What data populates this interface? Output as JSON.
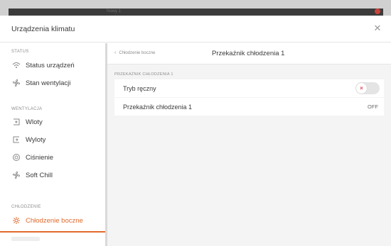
{
  "background": {
    "ghost_text": "Nowy 1"
  },
  "modal": {
    "title": "Urządzenia klimatu"
  },
  "sidebar": {
    "sections": [
      {
        "label": "STATUS",
        "items": [
          {
            "label": "Status urządzeń",
            "icon": "wifi-signal-icon"
          },
          {
            "label": "Stan wentylacji",
            "icon": "fan-icon"
          }
        ]
      },
      {
        "label": "WENTYLACJA",
        "items": [
          {
            "label": "Wloty",
            "icon": "inlet-icon"
          },
          {
            "label": "Wyloty",
            "icon": "outlet-icon"
          },
          {
            "label": "Ciśnienie",
            "icon": "pressure-gauge-icon"
          },
          {
            "label": "Soft Chill",
            "icon": "fan-icon"
          }
        ]
      },
      {
        "label": "CHŁODZENIE",
        "items": [
          {
            "label": "Chłodzenie boczne",
            "icon": "gear-icon",
            "active": true
          }
        ]
      }
    ]
  },
  "content": {
    "breadcrumb_back": "Chłodzenie boczne",
    "page_title": "Przekaźnik chłodzenia 1",
    "group_label": "PRZEKAŹNIK CHŁODZENIA 1",
    "rows": [
      {
        "label": "Tryb ręczny",
        "type": "toggle",
        "state": "off"
      },
      {
        "label": "Przekaźnik chłodzenia 1",
        "value": "OFF"
      }
    ]
  },
  "colors": {
    "accent": "#e26a2c",
    "toggle_x": "#e0475a"
  }
}
